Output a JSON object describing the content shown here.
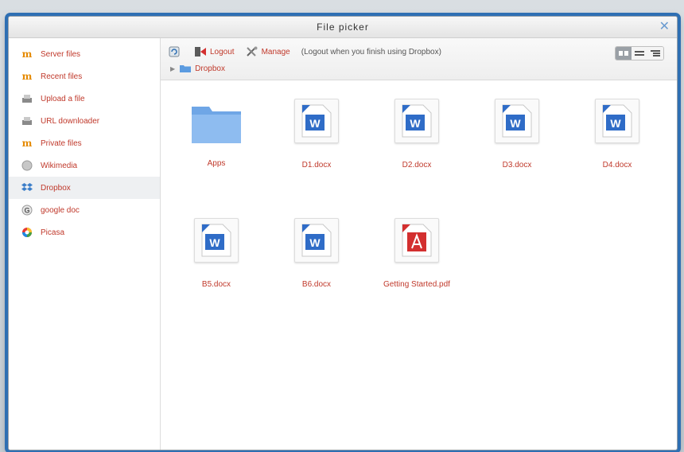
{
  "dialog": {
    "title": "File picker"
  },
  "sidebar": {
    "items": [
      {
        "label": "Server files",
        "icon": "moodle-icon",
        "active": false
      },
      {
        "label": "Recent files",
        "icon": "moodle-icon",
        "active": false
      },
      {
        "label": "Upload a file",
        "icon": "upload-icon",
        "active": false
      },
      {
        "label": "URL downloader",
        "icon": "url-icon",
        "active": false
      },
      {
        "label": "Private files",
        "icon": "moodle-icon",
        "active": false
      },
      {
        "label": "Wikimedia",
        "icon": "wikimedia-icon",
        "active": false
      },
      {
        "label": "Dropbox",
        "icon": "dropbox-icon",
        "active": true
      },
      {
        "label": "google doc",
        "icon": "google-icon",
        "active": false
      },
      {
        "label": "Picasa",
        "icon": "picasa-icon",
        "active": false
      }
    ]
  },
  "toolbar": {
    "logout_label": "Logout",
    "manage_label": "Manage",
    "note": "(Logout when you finish using Dropbox)"
  },
  "breadcrumb": {
    "label": "Dropbox"
  },
  "files": [
    {
      "name": "Apps",
      "kind": "folder"
    },
    {
      "name": "D1.docx",
      "kind": "docx"
    },
    {
      "name": "D2.docx",
      "kind": "docx"
    },
    {
      "name": "D3.docx",
      "kind": "docx"
    },
    {
      "name": "D4.docx",
      "kind": "docx"
    },
    {
      "name": "B5.docx",
      "kind": "docx"
    },
    {
      "name": "B6.docx",
      "kind": "docx"
    },
    {
      "name": "Getting Started.pdf",
      "kind": "pdf"
    }
  ],
  "colors": {
    "link": "#c0392b",
    "accent": "#2e6fb3"
  }
}
